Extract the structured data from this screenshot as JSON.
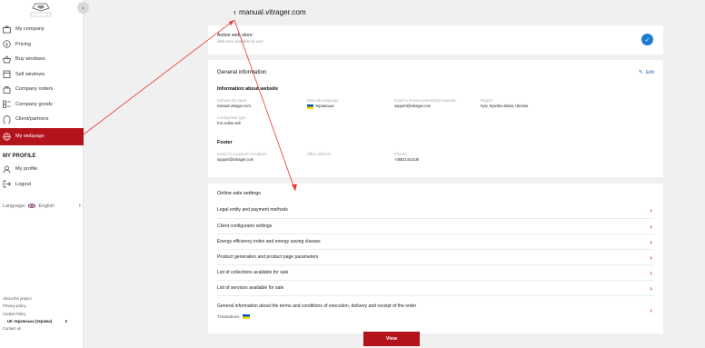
{
  "sidebar": {
    "logo_text": "VITRAGER.COM",
    "items": [
      {
        "label": "My company",
        "icon": "briefcase-icon"
      },
      {
        "label": "Pricing",
        "icon": "dollar-icon"
      },
      {
        "label": "Buy windows",
        "icon": "cart-icon"
      },
      {
        "label": "Sell windows",
        "icon": "shop-icon"
      },
      {
        "label": "Company orders",
        "icon": "bag-icon"
      },
      {
        "label": "Company goods",
        "icon": "goods-icon"
      },
      {
        "label": "Client/partners",
        "icon": "clients-icon"
      },
      {
        "label": "My webpage",
        "icon": "globe-icon"
      }
    ],
    "profile_title": "MY PROFILE",
    "profile_items": [
      {
        "label": "My profile",
        "icon": "user-icon"
      },
      {
        "label": "Logout",
        "icon": "logout-icon"
      }
    ],
    "language_label": "Language:",
    "language_value": "English",
    "footer": {
      "about": "About the project",
      "privacy": "Privacy policy",
      "cookie": "Cookie Policy",
      "locale": "UK Українська (Україна)",
      "contact": "Contact us"
    }
  },
  "page": {
    "domain": "manual.vitrager.com"
  },
  "store": {
    "title": "Active web store",
    "subtitle": "Web store available for user"
  },
  "general": {
    "title": "General information",
    "edit_label": "Edit",
    "website_heading": "Information about website",
    "fields": {
      "domain_label": "Domain city name",
      "domain_value": "manual.vitrager.com",
      "lang_label": "Main site language",
      "lang_value": "Українська",
      "email_label": "Email to receive partnership requests",
      "email_value": "support@vitrager.com",
      "region_label": "Region",
      "region_value": "Kyiv, Kyivska oblast, Ukraine",
      "config_label": "Configurator type",
      "config_value": "For online sell"
    },
    "footer_heading": "Footer",
    "footer_fields": {
      "feedback_label": "Email for customer's feedback",
      "feedback_value": "support@vitrager.com",
      "office_label": "Office address",
      "phones_label": "Phones",
      "phones_value": "+380214424J6"
    }
  },
  "online": {
    "title": "Online sale settings",
    "rows": [
      "Legal entity and payment methods",
      "Client configurator settings",
      "Energy efficiency index and energy saving classes",
      "Product generation and product page parameters",
      "List of collections available for sale",
      "List of services available for sale",
      "General information about the terms and conditions of execution, delivery and receipt of the order"
    ],
    "translations_label": "Translations",
    "view_button": "View"
  },
  "colors": {
    "accent": "#b3131b",
    "link": "#1e63c0",
    "toggle": "#1e7bd3"
  }
}
